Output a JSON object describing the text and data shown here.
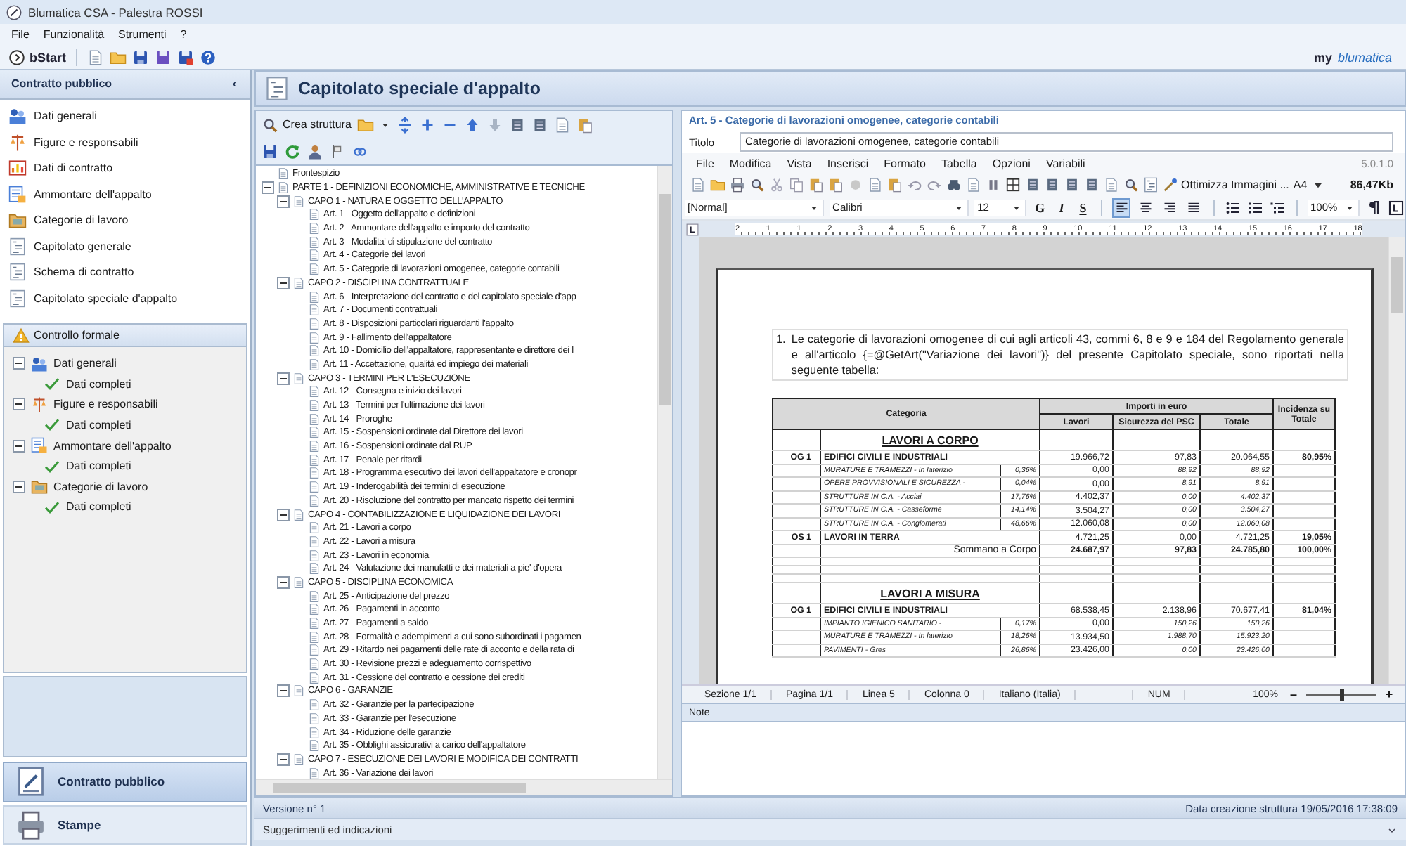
{
  "window": {
    "title": "Blumatica CSA - Palestra ROSSI"
  },
  "menu": [
    "File",
    "Funzionalità",
    "Strumenti",
    "?"
  ],
  "toolbar": {
    "start": "bStart",
    "logo_prefix": "my",
    "logo": "blumatica"
  },
  "sidebar": {
    "title": "Contratto pubblico",
    "collapse": "‹",
    "items": [
      {
        "label": "Dati generali",
        "selected": false
      },
      {
        "label": "Figure e responsabili",
        "selected": false
      },
      {
        "label": "Dati di contratto",
        "selected": false
      },
      {
        "label": "Ammontare dell'appalto",
        "selected": false
      },
      {
        "label": "Categorie di lavoro",
        "selected": false
      },
      {
        "label": "Capitolato generale",
        "selected": false
      },
      {
        "label": "Schema di contratto",
        "selected": false
      },
      {
        "label": "Capitolato speciale d'appalto",
        "selected": false
      }
    ],
    "check_panel": {
      "title": "Controllo formale",
      "tree": [
        {
          "label": "Dati generali",
          "expanded": true,
          "children": [
            {
              "label": "Dati completi"
            }
          ]
        },
        {
          "label": "Figure e responsabili",
          "expanded": true,
          "children": [
            {
              "label": "Dati completi"
            }
          ]
        },
        {
          "label": "Ammontare dell'appalto",
          "expanded": true,
          "children": [
            {
              "label": "Dati completi"
            }
          ]
        },
        {
          "label": "Categorie di lavoro",
          "expanded": true,
          "children": [
            {
              "label": "Dati completi"
            }
          ]
        }
      ]
    },
    "nav": [
      {
        "label": "Contratto pubblico",
        "selected": true
      },
      {
        "label": "Stampe",
        "selected": false
      }
    ]
  },
  "content": {
    "title": "Capitolato speciale d'appalto",
    "create": "Crea struttura",
    "tree": [
      {
        "label": "Frontespizio"
      },
      {
        "label": "PARTE 1 - DEFINIZIONI ECONOMICHE, AMMINISTRATIVE E TECNICHE",
        "expanded": true,
        "children": [
          {
            "label": "CAPO 1 - NATURA E OGGETTO DELL'APPALTO",
            "expanded": true,
            "children": [
              {
                "label": "Art. 1 - Oggetto dell'appalto e definizioni"
              },
              {
                "label": "Art. 2 - Ammontare dell'appalto e importo del contratto"
              },
              {
                "label": "Art. 3 - Modalita' di stipulazione del contratto"
              },
              {
                "label": "Art. 4 - Categorie dei lavori"
              },
              {
                "label": "Art. 5 - Categorie di lavorazioni omogenee, categorie contabili"
              }
            ]
          },
          {
            "label": "CAPO 2 - DISCIPLINA CONTRATTUALE",
            "expanded": true,
            "children": [
              {
                "label": "Art. 6 - Interpretazione del contratto e del capitolato speciale d'app"
              },
              {
                "label": "Art. 7 - Documenti contrattuali"
              },
              {
                "label": "Art. 8 - Disposizioni particolari riguardanti l'appalto"
              },
              {
                "label": "Art. 9 - Fallimento dell'appaltatore"
              },
              {
                "label": "Art. 10 - Domicilio dell'appaltatore, rappresentante e direttore dei l"
              },
              {
                "label": "Art. 11 - Accettazione, qualità ed impiego dei materiali"
              }
            ]
          },
          {
            "label": "CAPO 3 - TERMINI PER L'ESECUZIONE",
            "expanded": true,
            "children": [
              {
                "label": "Art. 12 - Consegna e inizio dei lavori"
              },
              {
                "label": "Art. 13 - Termini per l'ultimazione dei lavori"
              },
              {
                "label": "Art. 14 - Proroghe"
              },
              {
                "label": "Art. 15 - Sospensioni ordinate dal Direttore dei lavori"
              },
              {
                "label": "Art. 16 - Sospensioni ordinate dal RUP"
              },
              {
                "label": "Art. 17 - Penale per ritardi"
              },
              {
                "label": "Art. 18 - Programma esecutivo dei lavori dell'appaltatore e cronopr"
              },
              {
                "label": "Art. 19 - Inderogabilità dei termini di esecuzione"
              },
              {
                "label": "Art. 20 - Risoluzione del contratto per mancato rispetto dei termini"
              }
            ]
          },
          {
            "label": "CAPO 4 - CONTABILIZZAZIONE E LIQUIDAZIONE DEI LAVORI",
            "expanded": true,
            "children": [
              {
                "label": "Art. 21 - Lavori a corpo"
              },
              {
                "label": "Art. 22 - Lavori a misura"
              },
              {
                "label": "Art. 23 - Lavori in economia"
              },
              {
                "label": "Art. 24 - Valutazione dei manufatti e dei materiali a pie' d'opera"
              }
            ]
          },
          {
            "label": "CAPO 5 - DISCIPLINA ECONOMICA",
            "expanded": true,
            "children": [
              {
                "label": "Art. 25 - Anticipazione del prezzo"
              },
              {
                "label": "Art. 26 - Pagamenti in acconto"
              },
              {
                "label": "Art. 27 - Pagamenti a saldo"
              },
              {
                "label": "Art. 28 - Formalità e adempimenti a cui sono subordinati i pagamen"
              },
              {
                "label": "Art. 29 - Ritardo nei pagamenti delle rate di acconto e della rata di"
              },
              {
                "label": "Art. 30 - Revisione prezzi e adeguamento corrispettivo"
              },
              {
                "label": "Art. 31 - Cessione del contratto e cessione dei crediti"
              }
            ]
          },
          {
            "label": "CAPO 6 - GARANZIE",
            "expanded": true,
            "children": [
              {
                "label": "Art. 32 - Garanzie per la partecipazione"
              },
              {
                "label": "Art. 33 - Garanzie per l'esecuzione"
              },
              {
                "label": "Art. 34 - Riduzione delle garanzie"
              },
              {
                "label": "Art. 35 - Obblighi assicurativi a carico dell'appaltatore"
              }
            ]
          },
          {
            "label": "CAPO 7 - ESECUZIONE DEI LAVORI E MODIFICA DEI CONTRATTI",
            "expanded": true,
            "children": [
              {
                "label": "Art. 36 - Variazione dei lavori"
              }
            ]
          }
        ]
      }
    ],
    "editor": {
      "heading": "Art. 5 - Categorie di lavorazioni omogenee, categorie contabili",
      "title_label": "Titolo",
      "title_value": "Categorie di lavorazioni omogenee, categorie contabili",
      "menu": [
        "File",
        "Modifica",
        "Vista",
        "Inserisci",
        "Formato",
        "Tabella",
        "Opzioni",
        "Variabili"
      ],
      "version": "5.0.1.0",
      "optimize": "Ottimizza Immagini ...",
      "page_size": "A4",
      "file_size": "86,47Kb",
      "style": "[Normal]",
      "font": "Calibri",
      "font_size": "12",
      "bold": "G",
      "italic": "I",
      "underline": "S",
      "alignments": [
        {
          "selected": true
        },
        {
          "selected": false
        },
        {
          "selected": false
        },
        {
          "selected": false
        }
      ],
      "zoom_select": "100%",
      "ruler": [
        "2",
        "1",
        "1",
        "2",
        "3",
        "4",
        "5",
        "6",
        "7",
        "8",
        "9",
        "10",
        "11",
        "12",
        "13",
        "14",
        "15",
        "16",
        "17",
        "18"
      ],
      "paragraph": {
        "number": "1.",
        "text": "Le categorie di lavorazioni omogenee di cui agli articoli 43, commi 6, 8 e 9 e 184 del Regolamento generale e all'articolo {=@GetArt(\"Variazione dei lavori\")} del presente Capitolato speciale, sono riportati nella seguente tabella:"
      },
      "table": {
        "head": {
          "category": "Categoria",
          "group": "Importi in euro",
          "columns": [
            "Lavori",
            "Sicurezza del PSC",
            "Totale"
          ],
          "share": "Incidenza su Totale"
        },
        "rows": [
          {
            "kind": "section",
            "label": "LAVORI A CORPO"
          },
          {
            "kind": "main",
            "code": "OG 1",
            "label": "EDIFICI CIVILI E INDUSTRIALI",
            "values": [
              "19.966,72",
              "97,83",
              "20.064,55"
            ],
            "share": "80,95%"
          },
          {
            "kind": "sub",
            "label": "MURATURE E TRAMEZZI - In laterizio",
            "percent": "0,36%",
            "values": [
              "0,00",
              "88,92",
              "88,92"
            ]
          },
          {
            "kind": "sub",
            "label": "OPERE PROVVISIONALI E SICUREZZA -",
            "percent": "0,04%",
            "values": [
              "0,00",
              "8,91",
              "8,91"
            ]
          },
          {
            "kind": "sub",
            "label": "STRUTTURE IN C.A. - Acciai",
            "percent": "17,76%",
            "values": [
              "4.402,37",
              "0,00",
              "4.402,37"
            ]
          },
          {
            "kind": "sub",
            "label": "STRUTTURE IN C.A. - Casseforme",
            "percent": "14,14%",
            "values": [
              "3.504,27",
              "0,00",
              "3.504,27"
            ]
          },
          {
            "kind": "sub",
            "label": "STRUTTURE IN C.A. - Conglomerati",
            "percent": "48,66%",
            "values": [
              "12.060,08",
              "0,00",
              "12.060,08"
            ]
          },
          {
            "kind": "main",
            "code": "OS 1",
            "label": "LAVORI IN TERRA",
            "values": [
              "4.721,25",
              "0,00",
              "4.721,25"
            ],
            "share": "19,05%"
          },
          {
            "kind": "total",
            "label": "Sommano a Corpo",
            "values": [
              "24.687,97",
              "97,83",
              "24.785,80"
            ],
            "share": "100,00%"
          },
          {
            "kind": "blank"
          },
          {
            "kind": "blank"
          },
          {
            "kind": "blank"
          },
          {
            "kind": "section",
            "label": "LAVORI A MISURA"
          },
          {
            "kind": "main",
            "code": "OG 1",
            "label": "EDIFICI CIVILI E INDUSTRIALI",
            "values": [
              "68.538,45",
              "2.138,96",
              "70.677,41"
            ],
            "share": "81,04%"
          },
          {
            "kind": "sub",
            "label": "IMPIANTO IGIENICO SANITARIO -",
            "percent": "0,17%",
            "values": [
              "0,00",
              "150,26",
              "150,26"
            ]
          },
          {
            "kind": "sub",
            "label": "MURATURE E TRAMEZZI - In laterizio",
            "percent": "18,26%",
            "values": [
              "13.934,50",
              "1.988,70",
              "15.923,20"
            ]
          },
          {
            "kind": "sub",
            "label": "PAVIMENTI - Gres",
            "percent": "26,86%",
            "values": [
              "23.426,00",
              "0,00",
              "23.426,00"
            ]
          }
        ]
      },
      "status": [
        "Sezione 1/1",
        "Pagina 1/1",
        "Linea 5",
        "Colonna 0",
        "Italiano (Italia)",
        "NUM"
      ],
      "zoom": {
        "label": "100%",
        "zoom_out": "–",
        "zoom_in": "+",
        "level": 0.5
      },
      "notes_label": "Note"
    },
    "version": "Versione n° 1",
    "created": "Data creazione struttura 19/05/2016 17:38:09",
    "hints": "Suggerimenti ed indicazioni"
  }
}
